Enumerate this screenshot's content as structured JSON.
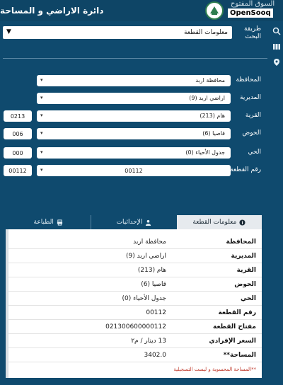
{
  "header": {
    "title": "دائرة الاراضي و المساحة",
    "watermark_ar": "السوق المفتوح",
    "watermark_en": "OpenSooq"
  },
  "search": {
    "label": "طريقة البحث",
    "value": "معلومات القطعة"
  },
  "form": {
    "rows": [
      {
        "label": "المحافظة",
        "value": "محافظة اربد",
        "code": ""
      },
      {
        "label": "المديرية",
        "value": "اراضي اربد (9)",
        "code": ""
      },
      {
        "label": "القرية",
        "value": "هام (213)",
        "code": "0213"
      },
      {
        "label": "الحوض",
        "value": "قاصيا (6)",
        "code": "006"
      },
      {
        "label": "الحي",
        "value": "جدول الأحياء (0)",
        "code": "000"
      },
      {
        "label": "رقم القطعة",
        "value": "00112",
        "code": "00112"
      }
    ]
  },
  "tabs": [
    {
      "label": "معلومات القطعة",
      "icon": "info-icon"
    },
    {
      "label": "الإحداثيات",
      "icon": "user-icon"
    },
    {
      "label": "الطباعة",
      "icon": "print-icon"
    }
  ],
  "info": {
    "rows": [
      {
        "key": "المحافظة",
        "value": "محافظة اربد"
      },
      {
        "key": "المديرية",
        "value": "اراضي اربد (9)"
      },
      {
        "key": "القرية",
        "value": "هام (213)"
      },
      {
        "key": "الحوض",
        "value": "قاصيا (6)"
      },
      {
        "key": "الحي",
        "value": "جدول الأحياء (0)"
      },
      {
        "key": "رقم القطعة",
        "value": "00112"
      },
      {
        "key": "مفتاح القطعة",
        "value": "021300600000112"
      },
      {
        "key": "السعر الإفرادي",
        "value": "13 دينار / م٢"
      },
      {
        "key": "المساحة**",
        "value": "3402.0"
      }
    ],
    "footnote": "**المساحة المحسوبة و ليست التسجيلية"
  },
  "colors": {
    "background": "#0f4a6e",
    "header": "#0e4566",
    "logo_green": "#2e7d4f",
    "footnote_red": "#c0392b"
  }
}
